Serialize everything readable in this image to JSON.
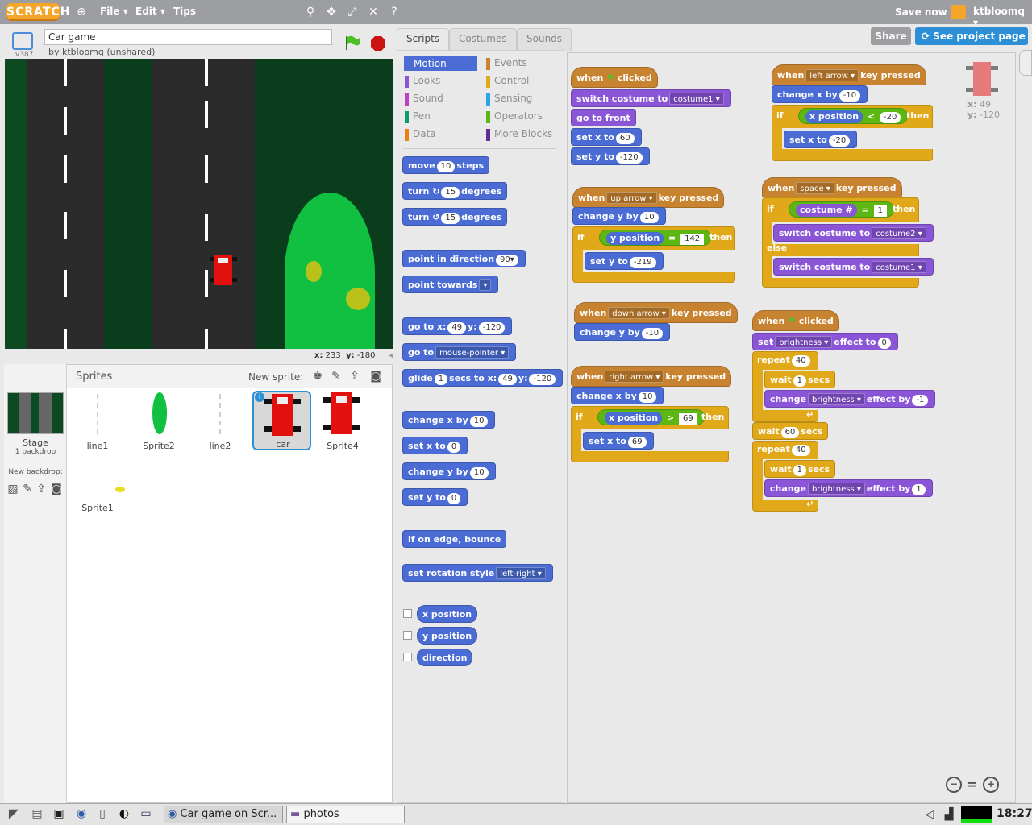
{
  "topbar": {
    "logo": "SCRATCH",
    "menus": [
      "File ▾",
      "Edit ▾",
      "Tips"
    ],
    "save_now": "Save now",
    "username": "ktbloomq ▾"
  },
  "project": {
    "version": "v387",
    "title": "Car game",
    "byline": "by ktbloomq (unshared)",
    "share": "Share",
    "see_project_page": "See project page"
  },
  "stage": {
    "x_label": "x:",
    "x_value": "233",
    "y_label": "y:",
    "y_value": "-180"
  },
  "sprites": {
    "header": "Sprites",
    "new_sprite": "New sprite:",
    "stage_label": "Stage",
    "stage_sub": "1 backdrop",
    "new_backdrop": "New backdrop:",
    "items": [
      "line1",
      "Sprite2",
      "line2",
      "car",
      "Sprite4",
      "Sprite1"
    ]
  },
  "tabs": [
    "Scripts",
    "Costumes",
    "Sounds"
  ],
  "categories": [
    {
      "label": "Motion",
      "color": "#4a6cd4"
    },
    {
      "label": "Events",
      "color": "#c88330"
    },
    {
      "label": "Looks",
      "color": "#8a55d7"
    },
    {
      "label": "Control",
      "color": "#e1a91a"
    },
    {
      "label": "Sound",
      "color": "#bb42c3"
    },
    {
      "label": "Sensing",
      "color": "#2ca5e2"
    },
    {
      "label": "Pen",
      "color": "#0e9a6c"
    },
    {
      "label": "Operators",
      "color": "#5cb712"
    },
    {
      "label": "Data",
      "color": "#ee7d16"
    },
    {
      "label": "More Blocks",
      "color": "#632d99"
    }
  ],
  "palette": {
    "move": [
      "move",
      "10",
      "steps"
    ],
    "turn_r": [
      "turn",
      "↻",
      "15",
      "degrees"
    ],
    "turn_l": [
      "turn",
      "↺",
      "15",
      "degrees"
    ],
    "point_dir": [
      "point in direction",
      "90▾"
    ],
    "point_towards": [
      "point towards",
      "▾"
    ],
    "goto_xy": [
      "go to x:",
      "49",
      "y:",
      "-120"
    ],
    "goto": [
      "go to",
      "mouse-pointer ▾"
    ],
    "glide": [
      "glide",
      "1",
      "secs to x:",
      "49",
      "y:",
      "-120"
    ],
    "change_x": [
      "change x by",
      "10"
    ],
    "set_x": [
      "set x to",
      "0"
    ],
    "change_y": [
      "change y by",
      "10"
    ],
    "set_y": [
      "set y to",
      "0"
    ],
    "bounce": "if on edge, bounce",
    "rot_style": [
      "set rotation style",
      "left-right ▾"
    ],
    "reporters": [
      "x position",
      "y position",
      "direction"
    ]
  },
  "scripts": {
    "when": "when",
    "clicked": "clicked",
    "key_pressed": "key pressed",
    "switch_costume": "switch costume to",
    "costume1": "costume1 ▾",
    "costume2": "costume2 ▾",
    "go_front": "go to front",
    "set_x_to": "set x to",
    "set_y_to": "set y to",
    "change_x_by": "change x by",
    "change_y_by": "change y by",
    "if": "if",
    "then": "then",
    "else": "else",
    "x_position": "x position",
    "y_position": "y position",
    "costume_num": "costume #",
    "left_arrow": "left arrow ▾",
    "right_arrow": "right arrow ▾",
    "up_arrow": "up arrow ▾",
    "down_arrow": "down arrow ▾",
    "space": "space ▾",
    "lt": "<",
    "gt": ">",
    "eq": "=",
    "v60": "60",
    "vm120": "-120",
    "vm10": "-10",
    "v10": "10",
    "vm20": "-20",
    "v142": "142",
    "vm219": "-219",
    "v69": "69",
    "v1": "1",
    "v0": "0",
    "v40": "40",
    "vm1": "-1",
    "set": "set",
    "brightness": "brightness ▾",
    "effect_to": "effect to",
    "effect_by": "effect by",
    "change": "change",
    "repeat": "repeat",
    "wait": "wait",
    "secs": "secs",
    "loop_arrow": "↵"
  },
  "sprite_info": {
    "x_label": "x:",
    "x_value": "49",
    "y_label": "y:",
    "y_value": "-120"
  },
  "zoom": {
    "out": "−",
    "reset": "=",
    "in": "+"
  },
  "taskbar": {
    "window1": "Car game on Scr...",
    "window2": "photos",
    "clock": "18:27"
  }
}
